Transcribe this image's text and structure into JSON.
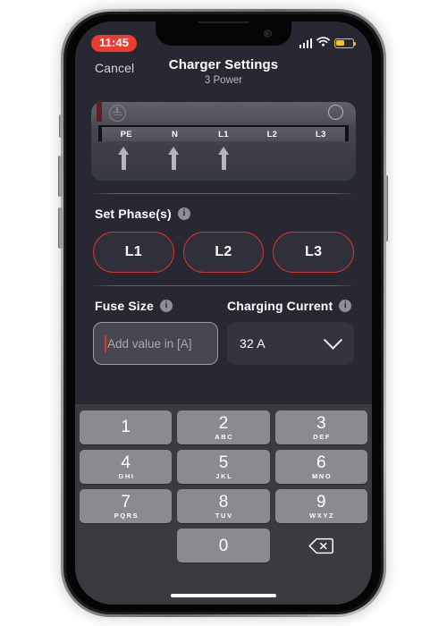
{
  "status_bar": {
    "time": "11:45",
    "signal_icon": "cellular-bars-icon",
    "wifi_icon": "wifi-icon",
    "battery_icon": "battery-low-power-icon",
    "battery_color": "#f2c325",
    "time_pill_color": "#ec3b33"
  },
  "nav": {
    "cancel_label": "Cancel",
    "title": "Charger Settings",
    "subtitle": "3 Power"
  },
  "diagram": {
    "name": "terminal-block-illustration",
    "ground_icon": "earth-ground-icon",
    "highlight_icon": "circle-outline-icon",
    "terminals": [
      "PE",
      "N",
      "L1",
      "L2",
      "L3"
    ],
    "arrows": [
      "arrow-up-icon",
      "arrow-up-icon",
      "arrow-up-icon"
    ]
  },
  "phases_section": {
    "title": "Set Phase(s)",
    "info_icon": "info-icon",
    "buttons": [
      {
        "label": "L1"
      },
      {
        "label": "L2"
      },
      {
        "label": "L3"
      }
    ],
    "border_color": "#d9342c"
  },
  "fuse_section": {
    "title": "Fuse Size",
    "info_icon": "info-icon",
    "input_placeholder": "Add value in [A]",
    "input_value": "",
    "caret_color": "#e0352c"
  },
  "current_section": {
    "title": "Charging Current",
    "info_icon": "info-icon",
    "selected_value": "32 A",
    "chevron_icon": "chevron-down-icon"
  },
  "keypad": {
    "rows": [
      [
        {
          "num": "1",
          "letters": ""
        },
        {
          "num": "2",
          "letters": "ABC"
        },
        {
          "num": "3",
          "letters": "DEF"
        }
      ],
      [
        {
          "num": "4",
          "letters": "GHI"
        },
        {
          "num": "5",
          "letters": "JKL"
        },
        {
          "num": "6",
          "letters": "MNO"
        }
      ],
      [
        {
          "num": "7",
          "letters": "PQRS"
        },
        {
          "num": "8",
          "letters": "TUV"
        },
        {
          "num": "9",
          "letters": "WXYZ"
        }
      ]
    ],
    "zero": {
      "num": "0",
      "letters": ""
    },
    "delete_icon": "backspace-delete-icon"
  },
  "home_indicator": "home-indicator"
}
